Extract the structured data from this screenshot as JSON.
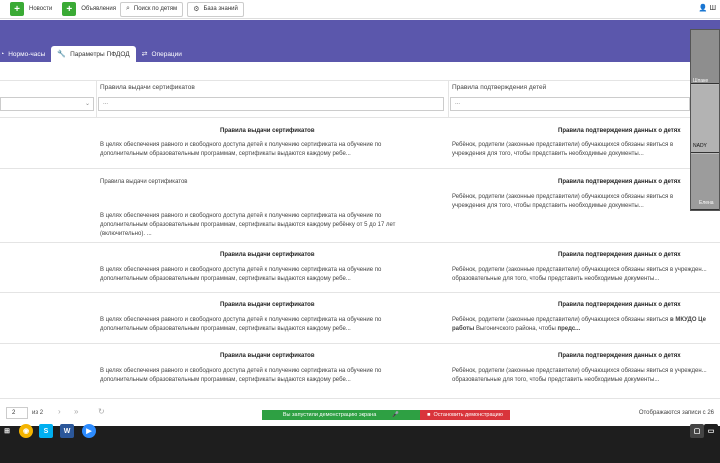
{
  "toolbar": {
    "news": "Новости",
    "ads": "Объявления",
    "search_children": "Поиск по детям",
    "knowledge_base": "База знаний",
    "user_initial": "Ш"
  },
  "tabs": [
    {
      "label": "Нормо-часы"
    },
    {
      "label": "Параметры ПФДОД"
    },
    {
      "label": "Операции"
    }
  ],
  "columns": {
    "col2": "Правила выдачи сертификатов",
    "col3": "Правила подтверждения детей"
  },
  "filters": {
    "col2": "...",
    "col3": "..."
  },
  "rows": [
    {
      "cert_title": "Правила выдачи сертификатов",
      "cert_text": "В целях обеспечения равного и свободного доступа детей к получению сертификата на обучение по дополнительным образовательным программам, сертификаты выдаются каждому ребе...",
      "confirm_title": "Правила подтверждения данных о детях",
      "confirm_text": "Ребёнок, родители (законные представители) обучающихся обязаны явиться в учреждения для того, чтобы представить необходимые документы..."
    },
    {
      "cert_plain": "Правила выдачи сертификатов",
      "cert_text": "В целях обеспечения равного и свободного доступа детей к получению сертификата на обучение по дополнительным образовательным программам, сертификаты выдаются каждому ребёнку от 5 до 17 лет (включительно). ...",
      "confirm_title": "Правила подтверждения данных о детях",
      "confirm_text": "Ребёнок, родители (законные представители) обучающихся обязаны явиться в учреждения для того, чтобы представить необходимые документы..."
    },
    {
      "cert_title": "Правила выдачи сертификатов",
      "cert_text": "В целях обеспечения равного и свободного доступа детей к получению сертификата на обучение по дополнительным образовательным программам, сертификаты выдаются каждому ребе...",
      "confirm_title": "Правила подтверждения данных о детях",
      "confirm_text": "Ребёнок, родители (законные представители) обучающихся обязаны явиться в учрежден... образовательные для того, чтобы представить необходимые документы..."
    },
    {
      "cert_title": "Правила выдачи сертификатов",
      "cert_text": "В целях обеспечения равного и свободного доступа детей к получению сертификата на обучение по дополнительным образовательным программам, сертификаты выдаются каждому ребе...",
      "confirm_title": "Правила подтверждения данных о детях",
      "confirm_text_a": "Ребёнок, родители (законные представители) обучающихся обязаны явиться ",
      "confirm_text_b": "в МКУДО Це",
      "confirm_text_c": "работы",
      "confirm_text_d": " Выгоничского района, чтобы ",
      "confirm_text_e": "предс..."
    },
    {
      "cert_title": "Правила выдачи сертификатов",
      "cert_text": "В целях обеспечения равного и свободного доступа детей к получению сертификата на обучение по дополнительным образовательным программам, сертификаты выдаются каждому ребе...",
      "confirm_title": "Правила подтверждения данных о детях",
      "confirm_text": "Ребёнок, родители (законные представители) обучающихся обязаны явиться в учрежден... образовательные для того, чтобы представить необходимые документы..."
    }
  ],
  "pager": {
    "page": "2",
    "of": "из 2",
    "info": "Отображаются записи с 26"
  },
  "demo": {
    "started": "Вы запустили демонстрацию экрана",
    "stop": "Остановить демонстрацию"
  },
  "video": {
    "name1": "Шпаке",
    "name2": "NADY",
    "name3": "Елена"
  }
}
